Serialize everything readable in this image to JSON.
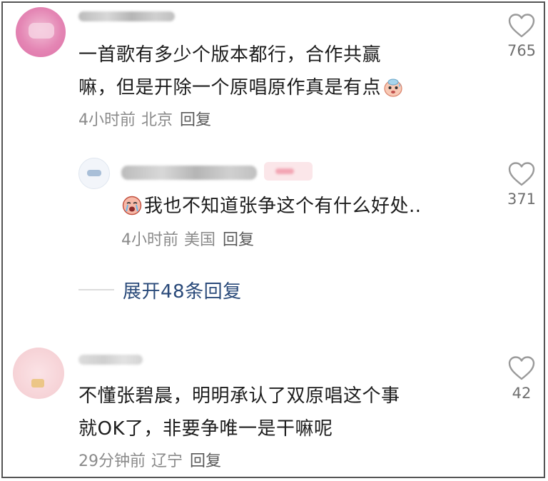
{
  "comments": [
    {
      "text_line1": "一首歌有多少个版本都行，合作共赢",
      "text_line2": "嘛，但是开除一个原唱原作真是有点",
      "emoji": "sweating-face-emoji",
      "time": "4小时前",
      "location": "北京",
      "reply_label": "回复",
      "likes": "765"
    }
  ],
  "reply": {
    "emoji": "crying-face-emoji",
    "text": "我也不知道张争这个有什么好处..",
    "time": "4小时前",
    "location": "美国",
    "reply_label": "回复",
    "likes": "371"
  },
  "expand_replies": {
    "label": "展开48条回复"
  },
  "comment2": {
    "text_line1": "不懂张碧晨，明明承认了双原唱这个事",
    "text_line2": "就OK了，非要争唯一是干嘛呢",
    "time": "29分钟前",
    "location": "辽宁",
    "reply_label": "回复",
    "likes": "42"
  },
  "icons": {
    "like": "heart-outline-icon"
  },
  "colors": {
    "text": "#1c1c1c",
    "meta": "#8a8a8a",
    "link": "#2a4a7a",
    "heart": "#9a9a9a"
  }
}
